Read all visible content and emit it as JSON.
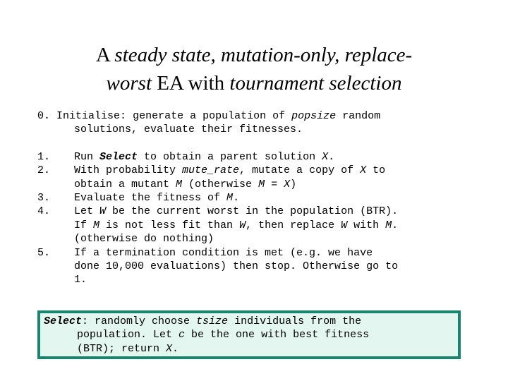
{
  "slide": {
    "background_color": "#ffffff",
    "text_color": "#000000"
  },
  "title": {
    "line1_part1": "A ",
    "line1_part2": "steady state, mutation-only, replace-",
    "line2_part1": "worst ",
    "line2_part2": "EA with ",
    "line2_part3": "tournament selection"
  },
  "steps": [
    {
      "number": "0.",
      "label": "Initialise:",
      "text_a": " generate a population of ",
      "var_a": "popsize",
      "text_b": " random",
      "cont1": "solutions, evaluate their fitnesses."
    },
    {
      "number": "1.",
      "text_a": "Run ",
      "keyword": "Select",
      "text_b": " to obtain a parent solution ",
      "var_a": "X",
      "text_c": "."
    },
    {
      "number": "2.",
      "text_a": "With probability ",
      "var_a": "mute_rate",
      "text_b": ", mutate a copy of ",
      "var_b": "X",
      "text_c": " to",
      "cont_a": "obtain a mutant ",
      "cont_var_a": "M",
      "cont_b": " (otherwise ",
      "cont_var_b": "M",
      "cont_c": " = ",
      "cont_var_c": "X",
      "cont_d": ")"
    },
    {
      "number": "3.",
      "text_a": "Evaluate the fitness of ",
      "var_a": "M",
      "text_b": "."
    },
    {
      "number": "4.",
      "text_a": "Let ",
      "var_a": "W",
      "text_b": " be the current worst in the population (BTR).",
      "line2_a": "If ",
      "line2_var_a": "M",
      "line2_b": " is not less fit than ",
      "line2_var_b": "W",
      "line2_c": ", then replace ",
      "line2_var_c": "W",
      "line2_d": " with ",
      "line2_var_d": "M",
      "line2_e": ".",
      "line3": "(otherwise do nothing)"
    },
    {
      "number": "5.",
      "text_a": "If a termination condition is met (e.g. we have",
      "line2": "done 10,000 evaluations) then stop. Otherwise go to",
      "line3": "1."
    }
  ],
  "select_box": {
    "border_color": "#17866c",
    "background_color": "#e4f6f0",
    "keyword": "Select",
    "text_a": ": randomly choose ",
    "var_a": "tsize",
    "text_b": " individuals from the",
    "line2_a": "population. Let ",
    "line2_var_a": "c",
    "line2_b": " be the one with best fitness",
    "line3_a": "(BTR); return ",
    "line3_var_a": "X",
    "line3_b": "."
  }
}
